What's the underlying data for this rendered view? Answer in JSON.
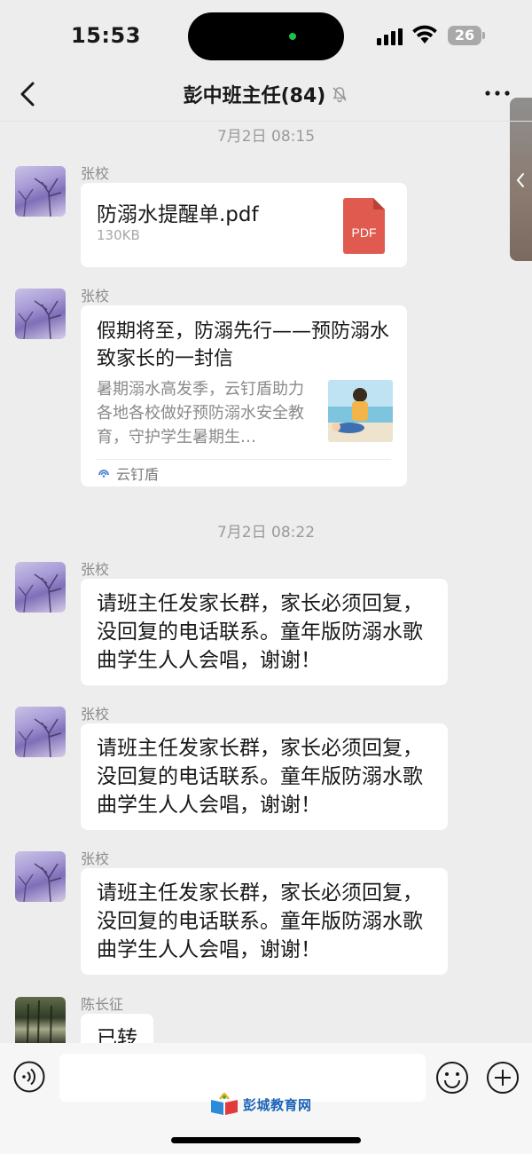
{
  "status_bar": {
    "time": "15:53",
    "battery": "26"
  },
  "nav": {
    "title": "彭中班主任(84)",
    "muted": true
  },
  "timestamps": [
    "7月2日 08:15",
    "7月2日 08:22"
  ],
  "messages": [
    {
      "sender": "张校",
      "type": "file",
      "file_name": "防溺水提醒单.pdf",
      "file_size": "130KB",
      "file_badge": "PDF"
    },
    {
      "sender": "张校",
      "type": "link",
      "title": "假期将至，防溺先行——预防溺水致家长的一封信",
      "description": "暑期溺水高发季，云钉盾助力各地各校做好预防溺水安全教育，守护学生暑期生…",
      "source": "云钉盾"
    },
    {
      "sender": "张校",
      "type": "text",
      "text": "请班主任发家长群，家长必须回复，没回复的电话联系。童年版防溺水歌曲学生人人会唱，谢谢！"
    },
    {
      "sender": "张校",
      "type": "text",
      "text": "请班主任发家长群，家长必须回复，没回复的电话联系。童年版防溺水歌曲学生人人会唱，谢谢！"
    },
    {
      "sender": "张校",
      "type": "text",
      "text": "请班主任发家长群，家长必须回复，没回复的电话联系。童年版防溺水歌曲学生人人会唱，谢谢！"
    },
    {
      "sender": "陈长征",
      "type": "text",
      "text": "已转"
    }
  ],
  "input": {
    "value": "",
    "placeholder": ""
  },
  "watermark": "彭城教育网",
  "colors": {
    "background": "#ededed",
    "bubble": "#ffffff",
    "pdf_red": "#e05a4f",
    "watermark_blue": "#1c63b8"
  }
}
